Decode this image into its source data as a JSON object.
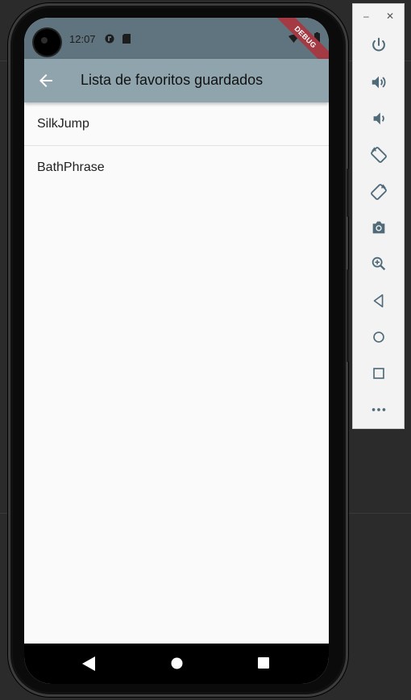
{
  "status_bar": {
    "time": "12:07",
    "debug_banner": "DEBUG"
  },
  "app_bar": {
    "title": "Lista de favoritos guardados",
    "back_icon": "arrow-back-icon"
  },
  "list": {
    "items": [
      {
        "label": "SilkJump"
      },
      {
        "label": "BathPhrase"
      }
    ]
  },
  "nav_bar": {
    "buttons": [
      "back-triangle-icon",
      "home-circle-icon",
      "recents-square-icon"
    ]
  },
  "emulator_toolbar": {
    "window_controls": {
      "minimize": "–",
      "close": "✕"
    },
    "icons": [
      "power-icon",
      "volume-up-icon",
      "volume-down-icon",
      "rotate-left-icon",
      "rotate-right-icon",
      "camera-icon",
      "zoom-icon",
      "back-icon",
      "home-icon",
      "overview-icon",
      "more-icon"
    ],
    "more_label": "•••"
  },
  "colors": {
    "app_bar": "#8fa4ad",
    "status_bar": "#5f747e",
    "screen_bg": "#fafafa",
    "debug_banner": "#a33a44"
  }
}
